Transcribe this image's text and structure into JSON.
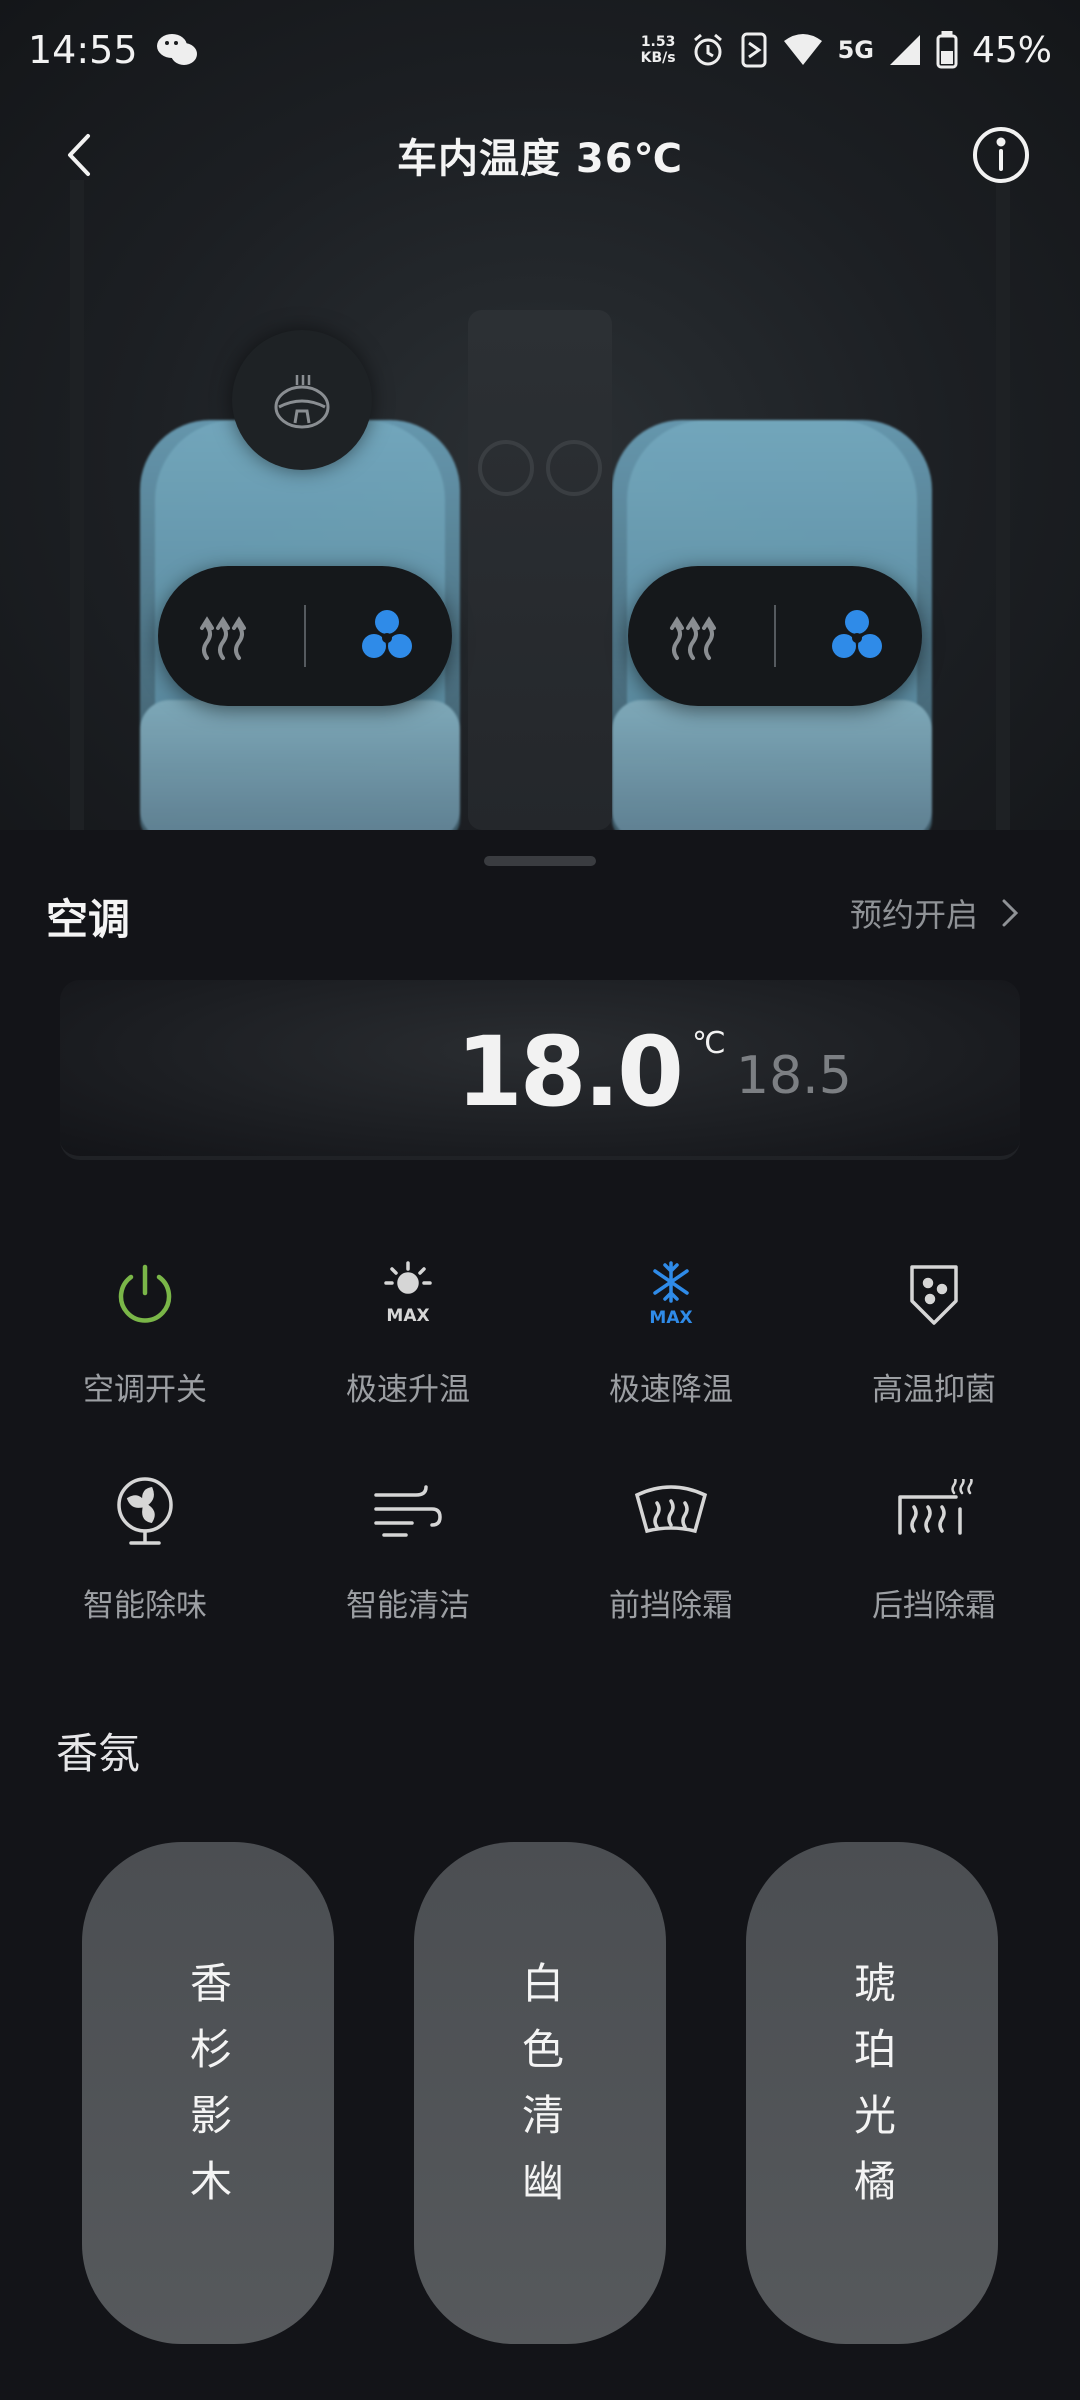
{
  "status_bar": {
    "time": "14:55",
    "speed_value": "1.53",
    "speed_unit": "KB/s",
    "network": "5G",
    "battery": "45%"
  },
  "header": {
    "title": "车内温度 36℃"
  },
  "ac": {
    "title": "空调",
    "schedule_label": "预约开启",
    "current_temp": "18.0",
    "temp_unit": "℃",
    "next_temp": "18.5"
  },
  "functions": [
    {
      "label": "空调开关",
      "icon": "power-icon",
      "color": "#7ab648"
    },
    {
      "label": "极速升温",
      "icon": "max-heat-icon",
      "color": "#d0d0d0"
    },
    {
      "label": "极速降温",
      "icon": "max-cool-icon",
      "color": "#3a8ee6"
    },
    {
      "label": "高温抑菌",
      "icon": "sterilize-icon",
      "color": "#d0d0d0"
    },
    {
      "label": "智能除味",
      "icon": "deodorize-fan-icon",
      "color": "#d0d0d0"
    },
    {
      "label": "智能清洁",
      "icon": "wind-clean-icon",
      "color": "#d0d0d0"
    },
    {
      "label": "前挡除霜",
      "icon": "front-defrost-icon",
      "color": "#d0d0d0"
    },
    {
      "label": "后挡除霜",
      "icon": "rear-defrost-icon",
      "color": "#d0d0d0"
    }
  ],
  "fragrance": {
    "title": "香氛",
    "items": [
      "香杉影木",
      "白色清幽",
      "琥珀光橘"
    ]
  },
  "colors": {
    "accent_blue": "#2f8be8",
    "power_green": "#7ab648",
    "background": "#131418"
  }
}
